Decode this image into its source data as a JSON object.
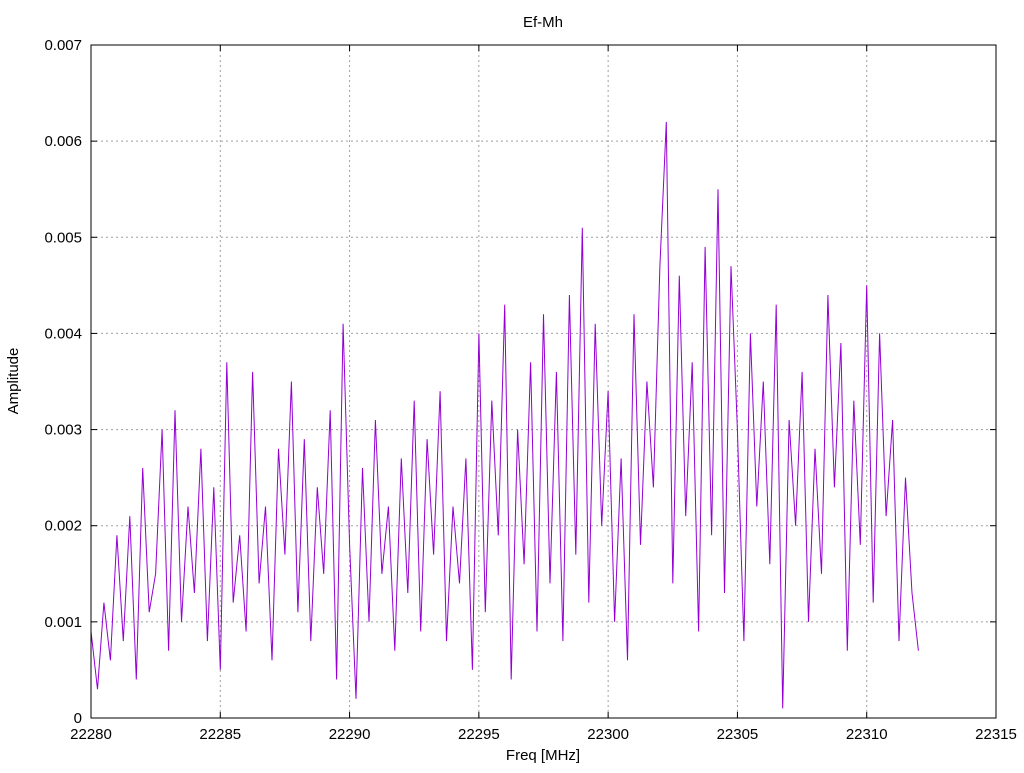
{
  "chart_data": {
    "type": "line",
    "title": "Ef-Mh",
    "xlabel": "Freq [MHz]",
    "ylabel": "Amplitude",
    "xlim": [
      22280,
      22315
    ],
    "ylim": [
      0,
      0.007
    ],
    "grid": true,
    "xticks": [
      "22280",
      "22285",
      "22290",
      "22295",
      "22300",
      "22305",
      "22310",
      "22315"
    ],
    "yticks": [
      "0",
      "0.001",
      "0.002",
      "0.003",
      "0.004",
      "0.005",
      "0.006",
      "0.007"
    ],
    "series": [
      {
        "name": "Ef-Mh",
        "color": "#9400d3",
        "x_start": 22280,
        "x_step": 0.25,
        "values": [
          0.0009,
          0.0003,
          0.0012,
          0.0006,
          0.0019,
          0.0008,
          0.0021,
          0.0004,
          0.0026,
          0.0011,
          0.0015,
          0.003,
          0.0007,
          0.0032,
          0.001,
          0.0022,
          0.0013,
          0.0028,
          0.0008,
          0.0024,
          0.0005,
          0.0037,
          0.0012,
          0.0019,
          0.0009,
          0.0036,
          0.0014,
          0.0022,
          0.0006,
          0.0028,
          0.0017,
          0.0035,
          0.0011,
          0.0029,
          0.0008,
          0.0024,
          0.0015,
          0.0032,
          0.0004,
          0.0041,
          0.0018,
          0.0002,
          0.0026,
          0.001,
          0.0031,
          0.0015,
          0.0022,
          0.0007,
          0.0027,
          0.0013,
          0.0033,
          0.0009,
          0.0029,
          0.0017,
          0.0034,
          0.0008,
          0.0022,
          0.0014,
          0.0027,
          0.0005,
          0.004,
          0.0011,
          0.0033,
          0.0019,
          0.0043,
          0.0004,
          0.003,
          0.0016,
          0.0037,
          0.0009,
          0.0042,
          0.0014,
          0.0036,
          0.0008,
          0.0044,
          0.0017,
          0.0051,
          0.0012,
          0.0041,
          0.002,
          0.0034,
          0.001,
          0.0027,
          0.0006,
          0.0042,
          0.0018,
          0.0035,
          0.0024,
          0.0047,
          0.0062,
          0.0014,
          0.0046,
          0.0021,
          0.0037,
          0.0009,
          0.0049,
          0.0019,
          0.0055,
          0.0013,
          0.0047,
          0.003,
          0.0008,
          0.004,
          0.0022,
          0.0035,
          0.0016,
          0.0043,
          0.0001,
          0.0031,
          0.002,
          0.0036,
          0.001,
          0.0028,
          0.0015,
          0.0044,
          0.0024,
          0.0039,
          0.0007,
          0.0033,
          0.0018,
          0.0045,
          0.0012,
          0.004,
          0.0021,
          0.0031,
          0.0008,
          0.0025,
          0.0013,
          0.0007
        ]
      }
    ]
  }
}
